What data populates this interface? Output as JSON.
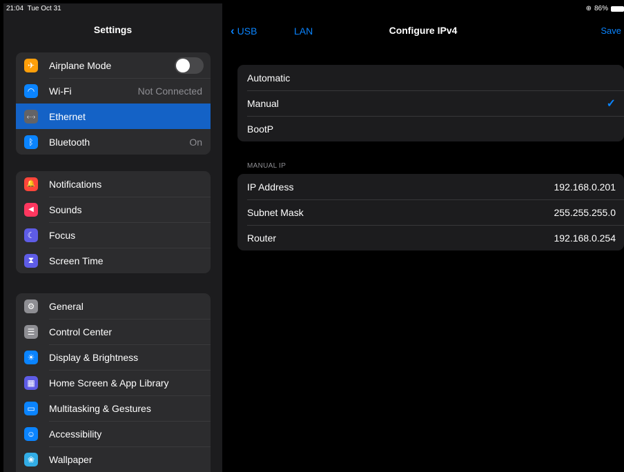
{
  "status": {
    "time": "21:04",
    "date": "Tue Oct 31",
    "battery": "86%",
    "orientation_icon": "orientation-lock-icon"
  },
  "sidebar": {
    "title": "Settings",
    "groups": [
      [
        {
          "label": "Airplane Mode",
          "icon": "airplane-icon",
          "color": "#ff9f0a",
          "glyph": "✈",
          "toggle": false
        },
        {
          "label": "Wi-Fi",
          "icon": "wifi-icon",
          "color": "#0a84ff",
          "glyph": "◠",
          "value": "Not Connected"
        },
        {
          "label": "Ethernet",
          "icon": "ethernet-icon",
          "color": "#636366",
          "glyph": "‹··›",
          "selected": true
        },
        {
          "label": "Bluetooth",
          "icon": "bluetooth-icon",
          "color": "#0a84ff",
          "glyph": "ᛒ",
          "value": "On"
        }
      ],
      [
        {
          "label": "Notifications",
          "icon": "notifications-icon",
          "color": "#ff453a",
          "glyph": "🔔"
        },
        {
          "label": "Sounds",
          "icon": "sounds-icon",
          "color": "#ff375f",
          "glyph": "◀"
        },
        {
          "label": "Focus",
          "icon": "focus-icon",
          "color": "#5e5ce6",
          "glyph": "☾"
        },
        {
          "label": "Screen Time",
          "icon": "screen-time-icon",
          "color": "#5e5ce6",
          "glyph": "⧗"
        }
      ],
      [
        {
          "label": "General",
          "icon": "general-icon",
          "color": "#8e8e93",
          "glyph": "⚙"
        },
        {
          "label": "Control Center",
          "icon": "control-center-icon",
          "color": "#8e8e93",
          "glyph": "☰"
        },
        {
          "label": "Display & Brightness",
          "icon": "display-brightness-icon",
          "color": "#0a84ff",
          "glyph": "☀"
        },
        {
          "label": "Home Screen & App Library",
          "icon": "home-screen-icon",
          "color": "#5e5ce6",
          "glyph": "▦"
        },
        {
          "label": "Multitasking & Gestures",
          "icon": "multitasking-icon",
          "color": "#0a84ff",
          "glyph": "▭"
        },
        {
          "label": "Accessibility",
          "icon": "accessibility-icon",
          "color": "#0a84ff",
          "glyph": "☺"
        },
        {
          "label": "Wallpaper",
          "icon": "wallpaper-icon",
          "color": "#32ade6",
          "glyph": "❀"
        }
      ]
    ]
  },
  "detail": {
    "nav": {
      "back_label": "USB",
      "lan_label": "LAN",
      "title": "Configure IPv4",
      "save_label": "Save"
    },
    "modes": [
      {
        "label": "Automatic",
        "checked": false
      },
      {
        "label": "Manual",
        "checked": true
      },
      {
        "label": "BootP",
        "checked": false
      }
    ],
    "manual_header": "MANUAL IP",
    "manual_fields": [
      {
        "label": "IP Address",
        "value": "192.168.0.201"
      },
      {
        "label": "Subnet Mask",
        "value": "255.255.255.0"
      },
      {
        "label": "Router",
        "value": "192.168.0.254"
      }
    ],
    "check_glyph": "✓",
    "accent": "#0a84ff"
  }
}
